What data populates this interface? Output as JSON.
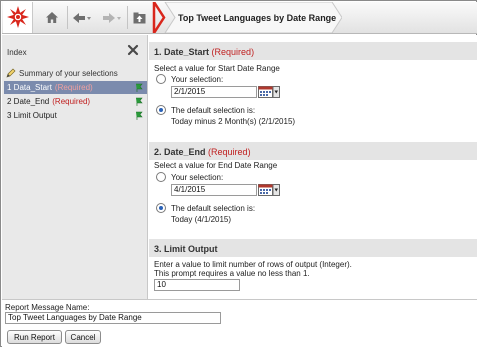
{
  "toolbar": {
    "breadcrumb_title": "Top Tweet Languages by Date Range"
  },
  "index": {
    "title": "Index",
    "summary_label": "Summary of your selections",
    "items": [
      {
        "label": "1 Data_Start",
        "required": "(Required)"
      },
      {
        "label": "2 Date_End",
        "required": "(Required)"
      },
      {
        "label": "3 Limit Output",
        "required": ""
      }
    ]
  },
  "sections": {
    "date_start": {
      "title": "1. Date_Start",
      "required": "(Required)",
      "instruction": "Select a value for Start Date Range",
      "your_selection_label": "Your selection:",
      "value": "2/1/2015",
      "default_label": "The default selection is:",
      "default_value": "Today minus 2 Month(s) (2/1/2015)"
    },
    "date_end": {
      "title": "2. Date_End",
      "required": "(Required)",
      "instruction": "Select a value for End Date Range",
      "your_selection_label": "Your selection:",
      "value": "4/1/2015",
      "default_label": "The default selection is:",
      "default_value": "Today (4/1/2015)"
    },
    "limit_output": {
      "title": "3. Limit Output",
      "instruction_line1": "Enter a value to limit number of rows of output (Integer).",
      "instruction_line2": "This prompt requires a value no less than 1.",
      "value": "10"
    }
  },
  "footer": {
    "message_name_label": "Report Message Name:",
    "message_name_value": "Top Tweet Languages by Date Range",
    "run_label": "Run Report",
    "cancel_label": "Cancel"
  },
  "colors": {
    "accent_red": "#d9261c",
    "selected_index": "#7b8bad",
    "required": "#c02020",
    "flag_green": "#2a9a3a"
  }
}
